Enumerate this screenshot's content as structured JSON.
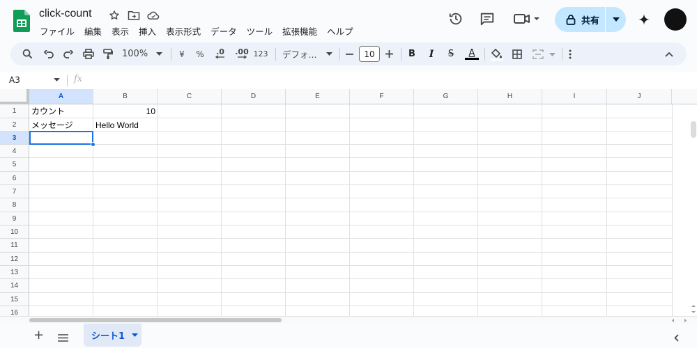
{
  "header": {
    "title": "click-count",
    "menus": [
      "ファイル",
      "編集",
      "表示",
      "挿入",
      "表示形式",
      "データ",
      "ツール",
      "拡張機能",
      "ヘルプ"
    ],
    "share_label": "共有"
  },
  "toolbar": {
    "zoom": "100%",
    "currency": "¥",
    "percent": "%",
    "dec_decrease": ".0",
    "dec_increase": ".00",
    "number_format": "123",
    "font": "デフォ...",
    "font_size": "10",
    "bold": "B",
    "italic": "I",
    "strike": "S",
    "text_color": "A"
  },
  "formula_bar": {
    "cell_ref": "A3",
    "fx": "fx"
  },
  "grid": {
    "columns": [
      "A",
      "B",
      "C",
      "D",
      "E",
      "F",
      "G",
      "H",
      "I",
      "J"
    ],
    "rows": [
      "1",
      "2",
      "3",
      "4",
      "5",
      "6",
      "7",
      "8",
      "9",
      "10",
      "11",
      "12",
      "13",
      "14",
      "15",
      "16"
    ],
    "cells": {
      "a1": "カウント",
      "b1": "10",
      "a2": "メッセージ",
      "b2": "Hello World"
    },
    "selected_cell": "A3"
  },
  "sheets": {
    "add": "+",
    "active_tab": "シート1"
  },
  "colors": {
    "accent": "#0b57d0",
    "selection": "#1a73e8",
    "share_bg": "#c2e7ff",
    "toolbar_bg": "#edf2fa"
  }
}
